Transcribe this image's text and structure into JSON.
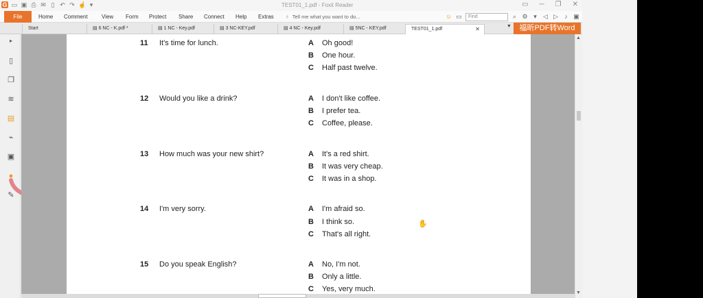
{
  "window": {
    "title": "TEST01_1.pdf - Foxit Reader"
  },
  "menu": {
    "file": "File",
    "items": [
      "Home",
      "Comment",
      "View",
      "Form",
      "Protect",
      "Share",
      "Connect",
      "Help",
      "Extras"
    ],
    "tell_me": "Tell me what you want to do...",
    "find_placeholder": "Find"
  },
  "tabs": [
    {
      "label": "Start",
      "active": false
    },
    {
      "label": "6 NC - K.pdf *",
      "active": false
    },
    {
      "label": "1 NC - Key.pdf",
      "active": false
    },
    {
      "label": "3 NC-KEY.pdf",
      "active": false
    },
    {
      "label": "4 NC - Key.pdf",
      "active": false
    },
    {
      "label": "5NC - KEY.pdf",
      "active": false
    },
    {
      "label": "TEST01_1.pdf",
      "active": true
    }
  ],
  "promo": "福昕PDF转Word",
  "questions": [
    {
      "num": "11",
      "text": "It's time for lunch.",
      "options": [
        {
          "letter": "A",
          "text": "Oh good!"
        },
        {
          "letter": "B",
          "text": "One hour."
        },
        {
          "letter": "C",
          "text": "Half past twelve."
        }
      ]
    },
    {
      "num": "12",
      "text": "Would you like a drink?",
      "options": [
        {
          "letter": "A",
          "text": "I don't like coffee."
        },
        {
          "letter": "B",
          "text": "I prefer tea."
        },
        {
          "letter": "C",
          "text": "Coffee, please."
        }
      ]
    },
    {
      "num": "13",
      "text": "How much was your new shirt?",
      "options": [
        {
          "letter": "A",
          "text": "It's a red shirt."
        },
        {
          "letter": "B",
          "text": "It was very cheap."
        },
        {
          "letter": "C",
          "text": "It was in a shop."
        }
      ]
    },
    {
      "num": "14",
      "text": "I'm very sorry.",
      "options": [
        {
          "letter": "A",
          "text": "I'm afraid so."
        },
        {
          "letter": "B",
          "text": "I think so."
        },
        {
          "letter": "C",
          "text": "That's all right."
        }
      ]
    },
    {
      "num": "15",
      "text": "Do you speak English?",
      "options": [
        {
          "letter": "A",
          "text": "No, I'm not."
        },
        {
          "letter": "B",
          "text": "Only a little."
        },
        {
          "letter": "C",
          "text": "Yes, very much."
        }
      ]
    }
  ],
  "colors": {
    "accent": "#e8742b",
    "doc_background": "#ababab",
    "annotation_stroke": "#e0707a"
  }
}
